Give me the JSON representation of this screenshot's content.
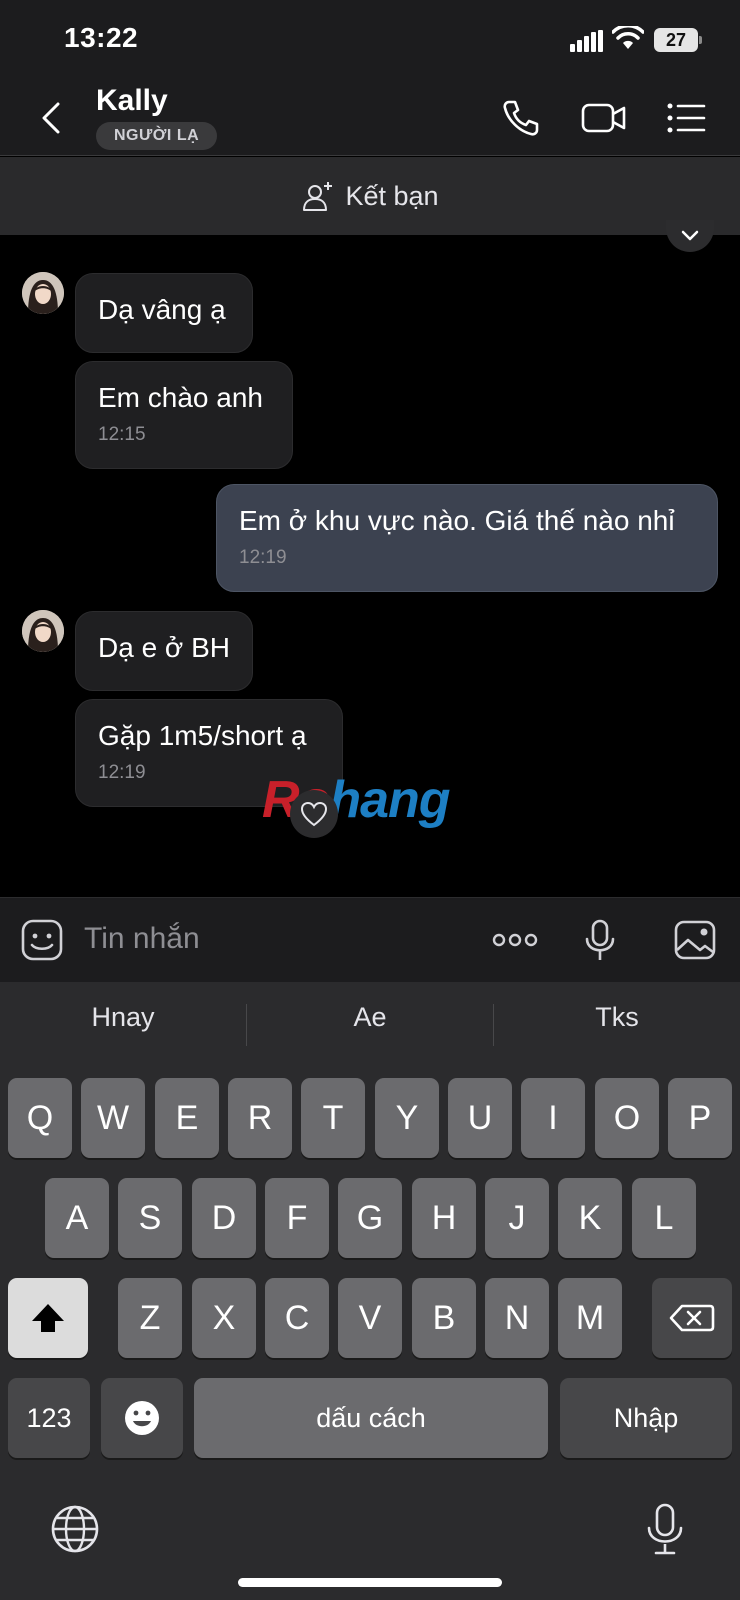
{
  "status": {
    "time": "13:22",
    "battery": "27"
  },
  "header": {
    "name": "Kally",
    "badge": "NGƯỜI LẠ"
  },
  "add_friend": {
    "label": "Kết bạn"
  },
  "messages": [
    {
      "dir": "in",
      "text": "Dạ vâng ạ",
      "time": ""
    },
    {
      "dir": "in",
      "text": "Em chào anh",
      "time": "12:15"
    },
    {
      "dir": "out",
      "text": "Em ở khu vực nào. Giá thế nào nhỉ",
      "time": "12:19"
    },
    {
      "dir": "in",
      "text": "Dạ e ở BH",
      "time": ""
    },
    {
      "dir": "in",
      "text": "Gặp 1m5/short ạ",
      "time": "12:19"
    }
  ],
  "watermark": {
    "part1": "Ro",
    "part2": "hang"
  },
  "input": {
    "placeholder": "Tin nhắn"
  },
  "keyboard": {
    "suggestions": [
      "Hnay",
      "Ae",
      "Tks"
    ],
    "row1": [
      "Q",
      "W",
      "E",
      "R",
      "T",
      "Y",
      "U",
      "I",
      "O",
      "P"
    ],
    "row2": [
      "A",
      "S",
      "D",
      "F",
      "G",
      "H",
      "J",
      "K",
      "L"
    ],
    "row3": [
      "Z",
      "X",
      "C",
      "V",
      "B",
      "N",
      "M"
    ],
    "numbers_key": "123",
    "space_key": "dấu cách",
    "return_key": "Nhập"
  }
}
